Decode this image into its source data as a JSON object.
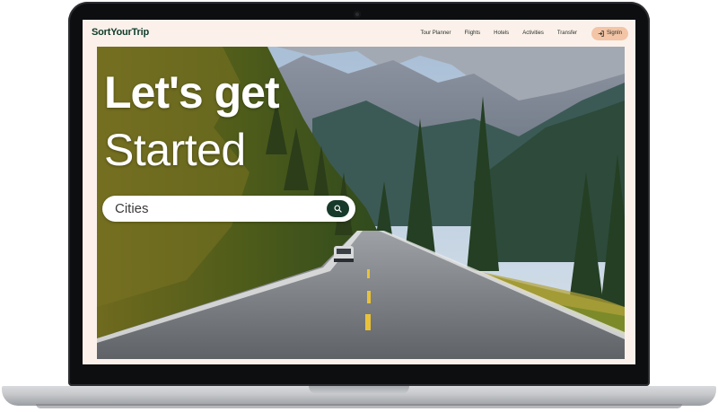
{
  "brand": {
    "logo": "SortYourTrip"
  },
  "nav": {
    "links": [
      "Tour Planner",
      "Flights",
      "Hotels",
      "Activities",
      "Transfer"
    ],
    "signin_label": "SignIn"
  },
  "hero": {
    "headline_line1": "Let's get",
    "headline_line2": "Started"
  },
  "search": {
    "placeholder": "Cities",
    "value": ""
  },
  "colors": {
    "brand_green": "#0f3b2a",
    "signin_bg": "#f3c4a6",
    "page_bg": "#fbf1ea",
    "search_button": "#173a2a"
  },
  "icons": {
    "signin": "login-arrow-icon",
    "search": "search-icon"
  }
}
